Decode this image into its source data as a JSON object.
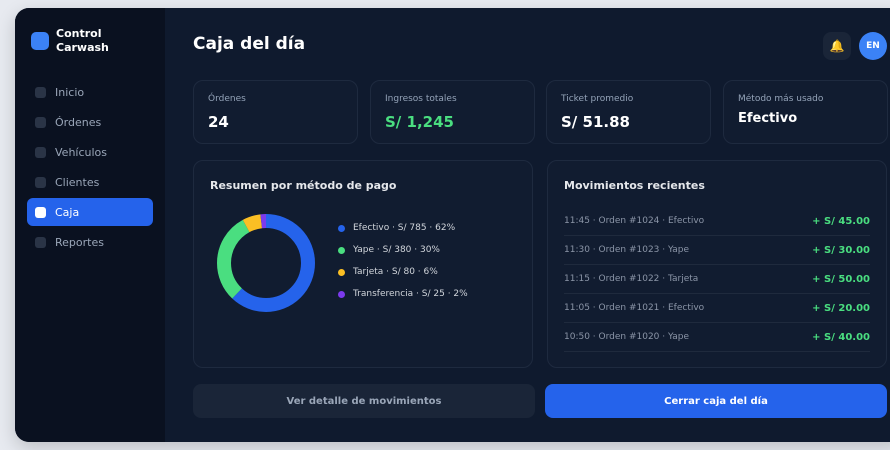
{
  "brand": {
    "line1": "Control",
    "line2": "Carwash"
  },
  "nav": {
    "items": [
      {
        "label": "Inicio"
      },
      {
        "label": "Órdenes"
      },
      {
        "label": "Vehículos"
      },
      {
        "label": "Clientes"
      },
      {
        "label": "Caja"
      },
      {
        "label": "Reportes"
      }
    ]
  },
  "header": {
    "title": "Caja del día",
    "avatar_initials": "EN"
  },
  "stats": [
    {
      "label": "Órdenes",
      "value": "24"
    },
    {
      "label": "Ingresos totales",
      "value": "S/ 1,245"
    },
    {
      "label": "Ticket promedio",
      "value": "S/ 51.88"
    },
    {
      "label": "Método más usado",
      "value": "Efectivo"
    }
  ],
  "payment_summary": {
    "title": "Resumen por método de pago",
    "legend": [
      {
        "label": "Efectivo · S/ 785 · 62%",
        "color": "#2563eb"
      },
      {
        "label": "Yape · S/ 380 · 30%",
        "color": "#4ade80"
      },
      {
        "label": "Tarjeta · S/ 80 · 6%",
        "color": "#fbbf24"
      },
      {
        "label": "Transferencia · S/ 25 · 2%",
        "color": "#7c3aed"
      }
    ]
  },
  "chart_data": {
    "type": "pie",
    "categories": [
      "Efectivo",
      "Yape",
      "Tarjeta",
      "Transferencia"
    ],
    "values": [
      62,
      30,
      6,
      2
    ],
    "amounts": [
      785,
      380,
      80,
      25
    ],
    "colors": [
      "#2563eb",
      "#4ade80",
      "#fbbf24",
      "#7c3aed"
    ]
  },
  "movements": {
    "title": "Movimientos recientes",
    "items": [
      {
        "desc": "11:45 · Orden #1024 · Efectivo",
        "amount": "+ S/ 45.00"
      },
      {
        "desc": "11:30 · Orden #1023 · Yape",
        "amount": "+ S/ 30.00"
      },
      {
        "desc": "11:15 · Orden #1022 · Tarjeta",
        "amount": "+ S/ 50.00"
      },
      {
        "desc": "11:05 · Orden #1021 · Efectivo",
        "amount": "+ S/ 20.00"
      },
      {
        "desc": "10:50 · Orden #1020 · Yape",
        "amount": "+ S/ 40.00"
      }
    ]
  },
  "actions": {
    "detail": "Ver detalle de movimientos",
    "close": "Cerrar caja del día"
  },
  "icons": {
    "bell": "bell-icon"
  }
}
